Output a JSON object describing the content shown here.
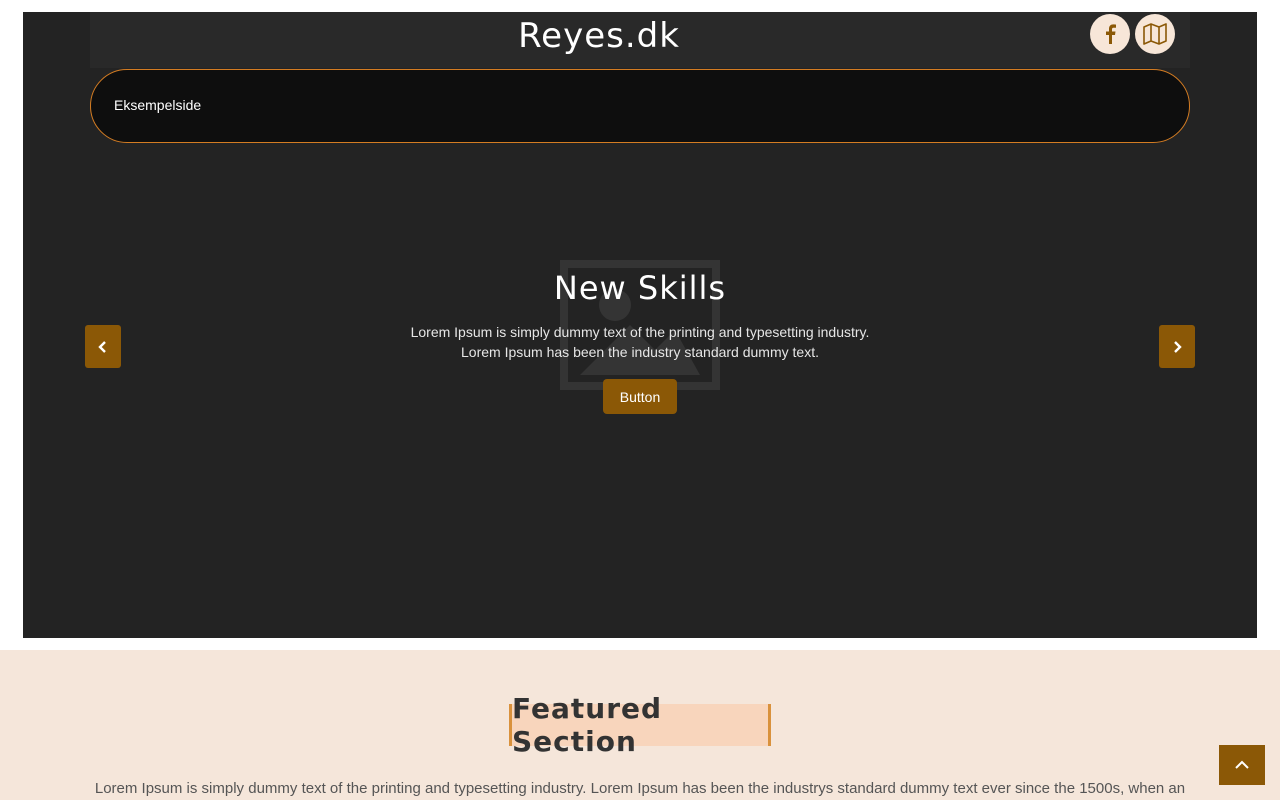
{
  "header": {
    "site_title": "Reyes.dk",
    "social": [
      {
        "icon": "facebook-icon"
      },
      {
        "icon": "map-icon"
      }
    ]
  },
  "nav": {
    "items": [
      "Eksempelside"
    ]
  },
  "slider": {
    "title": "New Skills",
    "text_line1": "Lorem Ipsum is simply dummy text of the printing and typesetting industry.",
    "text_line2": "Lorem Ipsum has been the industry standard dummy text.",
    "button_label": "Button"
  },
  "featured": {
    "title": "Featured Section",
    "text": "Lorem Ipsum is simply dummy text of the printing and typesetting industry. Lorem Ipsum has been the industrys standard dummy text ever since the 1500s, when an"
  },
  "colors": {
    "accent": "#8b5806",
    "border_accent": "#d47c22",
    "hero_bg": "#232323",
    "featured_bg": "#f5e6da",
    "social_bg": "#f7e6d8"
  }
}
